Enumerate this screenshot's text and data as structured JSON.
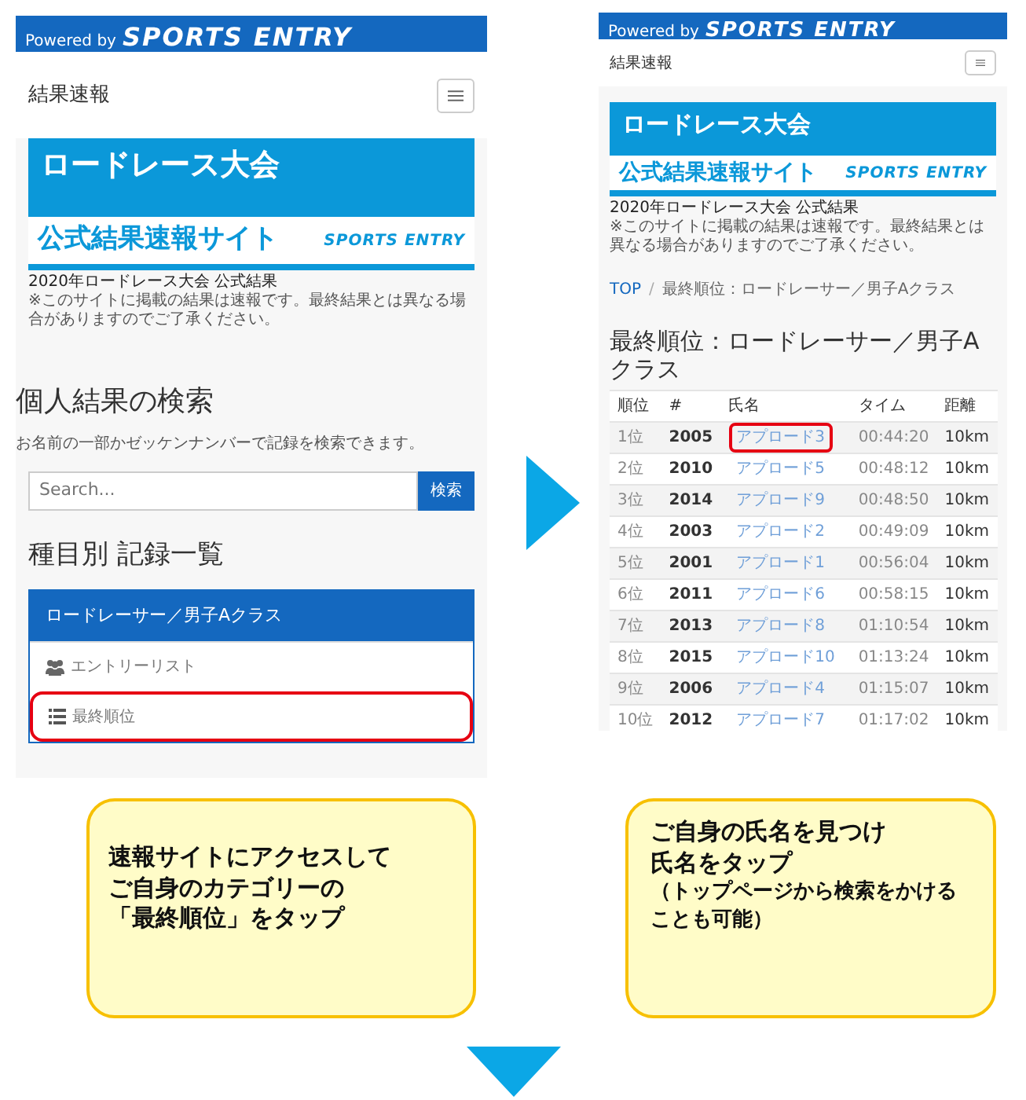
{
  "step1_screen": {
    "powered_by": "Powered by",
    "brand": "SPORTS ENTRY",
    "nav_title": "結果速報",
    "banner": {
      "title": "ロードレース大会",
      "subtitle": "公式結果速報サイト",
      "brand": "SPORTS ENTRY"
    },
    "notice_title": "2020年ロードレース大会 公式結果",
    "notice": "※このサイトに掲載の結果は速報です。最終結果とは異なる場合がありますのでご了承ください。",
    "search_heading": "個人結果の検索",
    "search_help": "お名前の一部かゼッケンナンバーで記録を検索できます。",
    "search": {
      "placeholder": "Search...",
      "button": "検索"
    },
    "list_heading": "種目別 記録一覧",
    "category": "ロードレーサー／男子Aクラス",
    "links": [
      {
        "kind": "people",
        "label": "エントリーリスト",
        "highlighted": false
      },
      {
        "kind": "list",
        "label": "最終順位",
        "highlighted": true
      }
    ]
  },
  "step2_screen": {
    "powered_by": "Powered by",
    "brand": "SPORTS ENTRY",
    "nav_title": "結果速報",
    "banner": {
      "title": "ロードレース大会",
      "subtitle": "公式結果速報サイト",
      "brand": "SPORTS ENTRY"
    },
    "notice_title": "2020年ロードレース大会 公式結果",
    "notice": "※このサイトに掲載の結果は速報です。最終結果とは異なる場合がありますのでご了承ください。",
    "breadcrumb_separator": "/",
    "breadcrumb": [
      "TOP",
      "最終順位：ロードレーサー／男子Aクラス"
    ],
    "heading": "最終順位：ロードレーサー／男子Aクラス",
    "table": {
      "columns": [
        "順位",
        "#",
        "氏名",
        "タイム",
        "距離"
      ],
      "rows": [
        {
          "rank": "1位",
          "number": "2005",
          "name": "アプロード3",
          "time": "00:44:20",
          "distance": "10km",
          "highlighted": true
        },
        {
          "rank": "2位",
          "number": "2010",
          "name": "アプロード5",
          "time": "00:48:12",
          "distance": "10km",
          "highlighted": false
        },
        {
          "rank": "3位",
          "number": "2014",
          "name": "アプロード9",
          "time": "00:48:50",
          "distance": "10km",
          "highlighted": false
        },
        {
          "rank": "4位",
          "number": "2003",
          "name": "アプロード2",
          "time": "00:49:09",
          "distance": "10km",
          "highlighted": false
        },
        {
          "rank": "5位",
          "number": "2001",
          "name": "アプロード1",
          "time": "00:56:04",
          "distance": "10km",
          "highlighted": false
        },
        {
          "rank": "6位",
          "number": "2011",
          "name": "アプロード6",
          "time": "00:58:15",
          "distance": "10km",
          "highlighted": false
        },
        {
          "rank": "7位",
          "number": "2013",
          "name": "アプロード8",
          "time": "01:10:54",
          "distance": "10km",
          "highlighted": false
        },
        {
          "rank": "8位",
          "number": "2015",
          "name": "アプロード10",
          "time": "01:13:24",
          "distance": "10km",
          "highlighted": false
        },
        {
          "rank": "9位",
          "number": "2006",
          "name": "アプロード4",
          "time": "01:15:07",
          "distance": "10km",
          "highlighted": false
        },
        {
          "rank": "10位",
          "number": "2012",
          "name": "アプロード7",
          "time": "01:17:02",
          "distance": "10km",
          "highlighted": false
        }
      ]
    }
  },
  "callouts": [
    {
      "lines": [
        "速報サイトにアクセスして",
        "ご自身のカテゴリーの",
        "「最終順位」をタップ"
      ]
    },
    {
      "lines": [
        "ご自身の氏名を見つけ",
        "氏名をタップ"
      ],
      "note": "（トップページから検索をかけることも可能）"
    }
  ]
}
